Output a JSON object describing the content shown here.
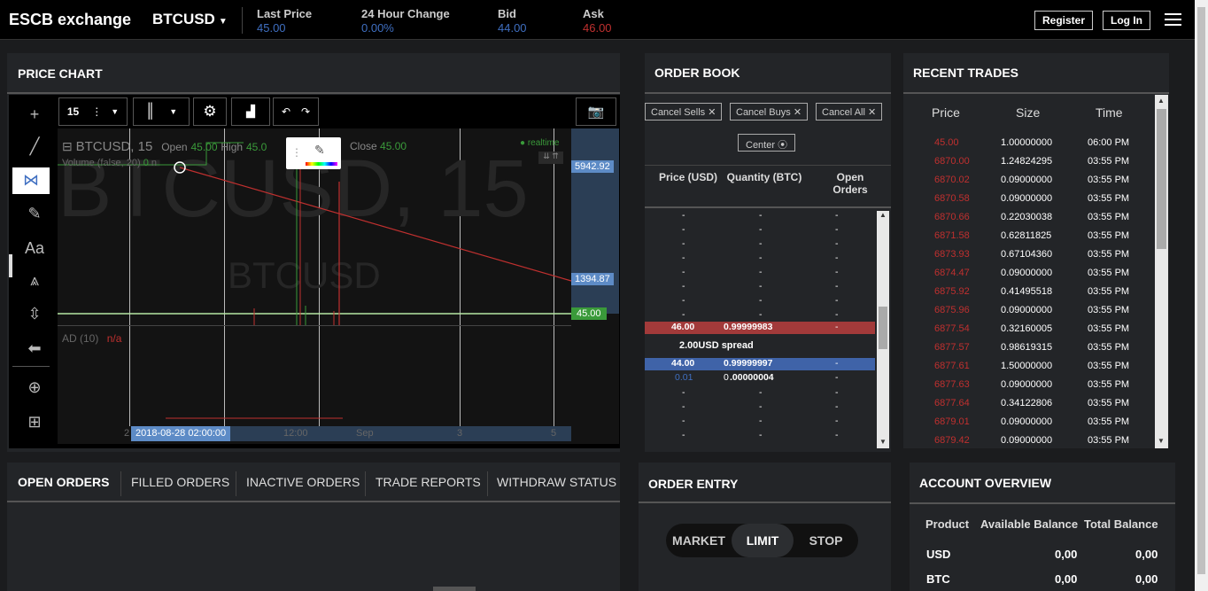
{
  "header": {
    "brand": "ESCB exchange",
    "pair": "BTCUSD",
    "stats": [
      {
        "label": "Last Price",
        "value": "45.00",
        "color": "#3f6fc1"
      },
      {
        "label": "24 Hour Change",
        "value": "0.00%",
        "color": "#3f6fc1"
      },
      {
        "label": "Bid",
        "value": "44.00",
        "color": "#3f6fc1"
      },
      {
        "label": "Ask",
        "value": "46.00",
        "color": "#c0302f"
      }
    ],
    "register": "Register",
    "login": "Log In",
    "menu_icon": "hamburger-menu-icon"
  },
  "chart": {
    "title": "PRICE CHART",
    "interval": "15",
    "symbol": "BTCUSD, 15",
    "open_label": "Open",
    "open": "45.00",
    "high_label": "High",
    "high": "45.0",
    "close_label": "Close",
    "close": "45.00",
    "volume": "Volume (false, 20)",
    "volume_val": "0",
    "volume_suffix": "n",
    "realtime": "realtime",
    "watermark_big": "BTCUSD, 15",
    "watermark_small": "BTCUSD",
    "ad": "AD (10)",
    "ad_val": "n/a",
    "price_badges": [
      "5942.92",
      "1394.87",
      "45.00"
    ],
    "x_labels": [
      "2",
      "12:00",
      "Sep",
      "3",
      "5"
    ],
    "cursor_date": "2018-08-28 02:00:00"
  },
  "orderbook": {
    "title": "ORDER BOOK",
    "cancel_sells": "Cancel Sells",
    "cancel_buys": "Cancel Buys",
    "cancel_all": "Cancel All",
    "center": "Center",
    "col_price": "Price (USD)",
    "col_qty": "Quantity (BTC)",
    "col_open": "Open Orders",
    "ask": {
      "price": "46.00",
      "qty": "0.99999983",
      "open": "-"
    },
    "spread": "2.00USD spread",
    "bid": {
      "price": "44.00",
      "qty": "0.99999997",
      "open": "-"
    },
    "small": {
      "price": "0.01",
      "qty_int": "0",
      "qty_dec": ".00000004",
      "open": "-"
    },
    "dash": "-"
  },
  "recent": {
    "title": "RECENT TRADES",
    "cols": [
      "Price",
      "Size",
      "Time"
    ],
    "rows": [
      [
        "45.00",
        "1.00000000",
        "06:00 PM"
      ],
      [
        "6870.00",
        "1.24824295",
        "03:55 PM"
      ],
      [
        "6870.02",
        "0.09000000",
        "03:55 PM"
      ],
      [
        "6870.58",
        "0.09000000",
        "03:55 PM"
      ],
      [
        "6870.66",
        "0.22030038",
        "03:55 PM"
      ],
      [
        "6871.58",
        "0.62811825",
        "03:55 PM"
      ],
      [
        "6873.93",
        "0.67104360",
        "03:55 PM"
      ],
      [
        "6874.47",
        "0.09000000",
        "03:55 PM"
      ],
      [
        "6875.92",
        "0.41495518",
        "03:55 PM"
      ],
      [
        "6875.96",
        "0.09000000",
        "03:55 PM"
      ],
      [
        "6877.54",
        "0.32160005",
        "03:55 PM"
      ],
      [
        "6877.57",
        "0.98619315",
        "03:55 PM"
      ],
      [
        "6877.61",
        "1.50000000",
        "03:55 PM"
      ],
      [
        "6877.63",
        "0.09000000",
        "03:55 PM"
      ],
      [
        "6877.64",
        "0.34122806",
        "03:55 PM"
      ],
      [
        "6879.01",
        "0.09000000",
        "03:55 PM"
      ],
      [
        "6879.42",
        "0.09000000",
        "03:55 PM"
      ]
    ]
  },
  "orders": {
    "tabs": [
      "OPEN ORDERS",
      "FILLED ORDERS",
      "INACTIVE ORDERS",
      "TRADE REPORTS",
      "WITHDRAW STATUS"
    ]
  },
  "entry": {
    "title": "ORDER ENTRY",
    "market": "MARKET",
    "limit": "LIMIT",
    "stop": "STOP"
  },
  "account": {
    "title": "ACCOUNT OVERVIEW",
    "cols": [
      "Product",
      "Available Balance",
      "Total Balance"
    ],
    "rows": [
      [
        "USD",
        "0,00",
        "0,00"
      ],
      [
        "BTC",
        "0,00",
        "0,00"
      ]
    ]
  },
  "colors": {
    "ask": "#c0302f",
    "bid": "#3f6fc1",
    "green": "#44aa44"
  }
}
